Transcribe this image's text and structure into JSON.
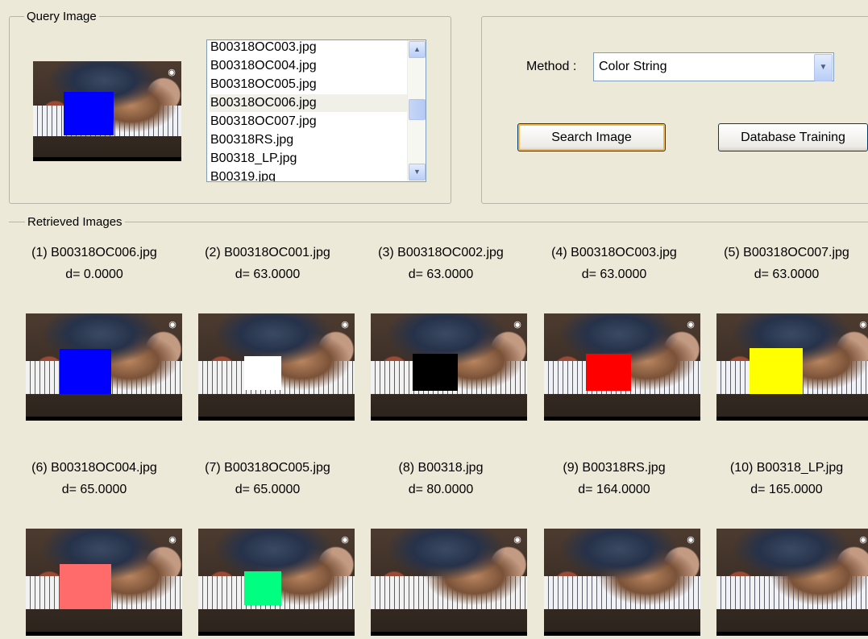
{
  "query_panel": {
    "title": "Query Image",
    "patch_color": "#0000ff",
    "file_list": [
      "B00318OC003.jpg",
      "B00318OC004.jpg",
      "B00318OC005.jpg",
      "B00318OC006.jpg",
      "B00318OC007.jpg",
      "B00318RS.jpg",
      "B00318_LP.jpg",
      "B00319.jpg"
    ],
    "selected_file": "B00318OC006.jpg"
  },
  "controls": {
    "method_label": "Method :",
    "method_value": "Color String",
    "search_button": "Search Image",
    "training_button": "Database Training"
  },
  "results_panel": {
    "title": "Retrieved Images",
    "results": [
      {
        "label": "(1) B00318OC006.jpg",
        "distance": "d=  0.0000",
        "patch_color": "#0000ff"
      },
      {
        "label": "(2) B00318OC001.jpg",
        "distance": "d=  63.0000",
        "patch_color": "#ffffff"
      },
      {
        "label": "(3) B00318OC002.jpg",
        "distance": "d=  63.0000",
        "patch_color": "#000000"
      },
      {
        "label": "(4) B00318OC003.jpg",
        "distance": "d=  63.0000",
        "patch_color": "#ff0000"
      },
      {
        "label": "(5) B00318OC007.jpg",
        "distance": "d=  63.0000",
        "patch_color": "#ffff00"
      },
      {
        "label": "(6) B00318OC004.jpg",
        "distance": "d=  65.0000",
        "patch_color": "#ff6b6b"
      },
      {
        "label": "(7) B00318OC005.jpg",
        "distance": "d=  65.0000",
        "patch_color": "#00ff80"
      },
      {
        "label": "(8) B00318.jpg",
        "distance": "d=  80.0000",
        "patch_color": null
      },
      {
        "label": "(9) B00318RS.jpg",
        "distance": "d= 164.0000",
        "patch_color": null
      },
      {
        "label": "(10) B00318_LP.jpg",
        "distance": "d= 165.0000",
        "patch_color": null
      }
    ]
  }
}
